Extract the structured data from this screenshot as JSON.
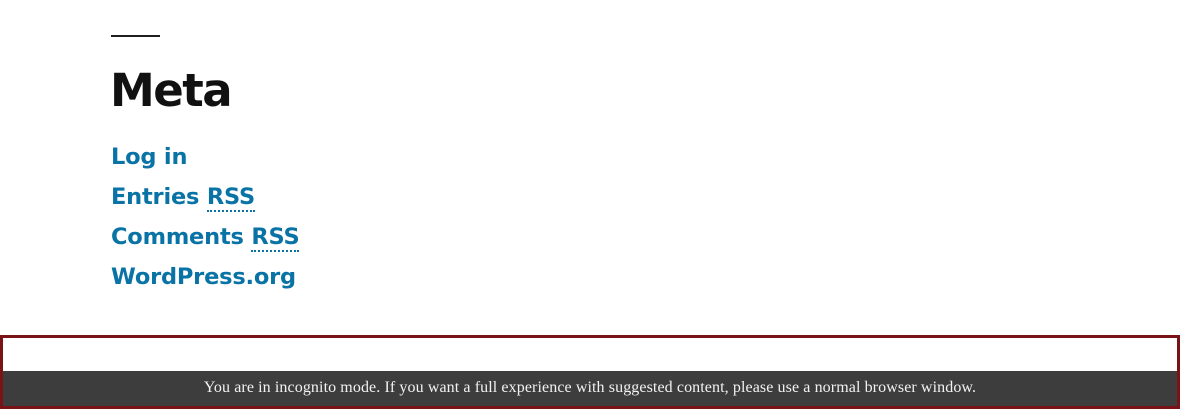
{
  "widget": {
    "title": "Meta",
    "links": [
      {
        "text": "Log in",
        "abbr": ""
      },
      {
        "text": "Entries ",
        "abbr": "RSS"
      },
      {
        "text": "Comments ",
        "abbr": "RSS"
      },
      {
        "text": "WordPress.org",
        "abbr": ""
      }
    ]
  },
  "banner": {
    "message": "You are in incognito mode. If you want a full experience with suggested content, please use a normal browser window."
  },
  "colors": {
    "link": "#0a73a6",
    "title": "#111111",
    "banner_border": "#7a1316",
    "banner_background": "#3d3d3d"
  }
}
